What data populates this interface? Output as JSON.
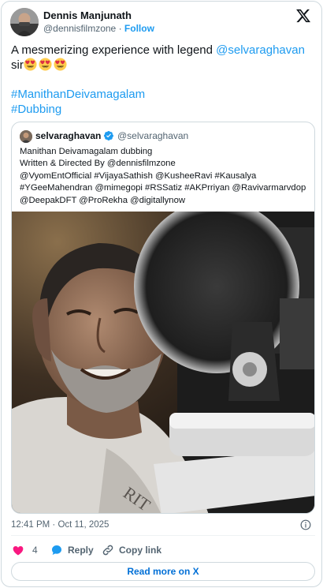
{
  "author": {
    "name": "Dennis Manjunath",
    "handle": "@dennisfilmzone",
    "separator": "·",
    "follow_label": "Follow"
  },
  "tweet": {
    "text_part1": "A mesmerizing experience with legend ",
    "mention": "@selvaraghavan",
    "text_part2": "sir",
    "emojis": [
      "heart-eyes-emoji",
      "heart-eyes-emoji",
      "heart-eyes-emoji"
    ],
    "hashtags": [
      "#ManithanDeivamagalam",
      "#Dubbing"
    ]
  },
  "quoted": {
    "name": "selvaraghavan",
    "handle": "@selvaraghavan",
    "lines": [
      "Manithan Deivamagalam dubbing",
      "Written & Directed By @dennisfilmzone",
      "@VyomEntOfficial #VijayaSathish @KusheeRavi #Kausalya",
      "#YGeeMahendran @mimegopi #RSSatiz #AKPrriyan @Ravivarmarvdop",
      "@DeepakDFT @ProRekha @digitallynow"
    ],
    "media": "photo of man smiling beside studio microphone"
  },
  "footer": {
    "timestamp": "12:41 PM · Oct 11, 2025",
    "like_count": "4",
    "reply_label": "Reply",
    "copy_label": "Copy link",
    "read_more_label": "Read more on X"
  },
  "colors": {
    "accent": "#1d9bf0",
    "like": "#f91880",
    "text": "#0f1419",
    "muted": "#536471",
    "border": "#cfd9de"
  }
}
